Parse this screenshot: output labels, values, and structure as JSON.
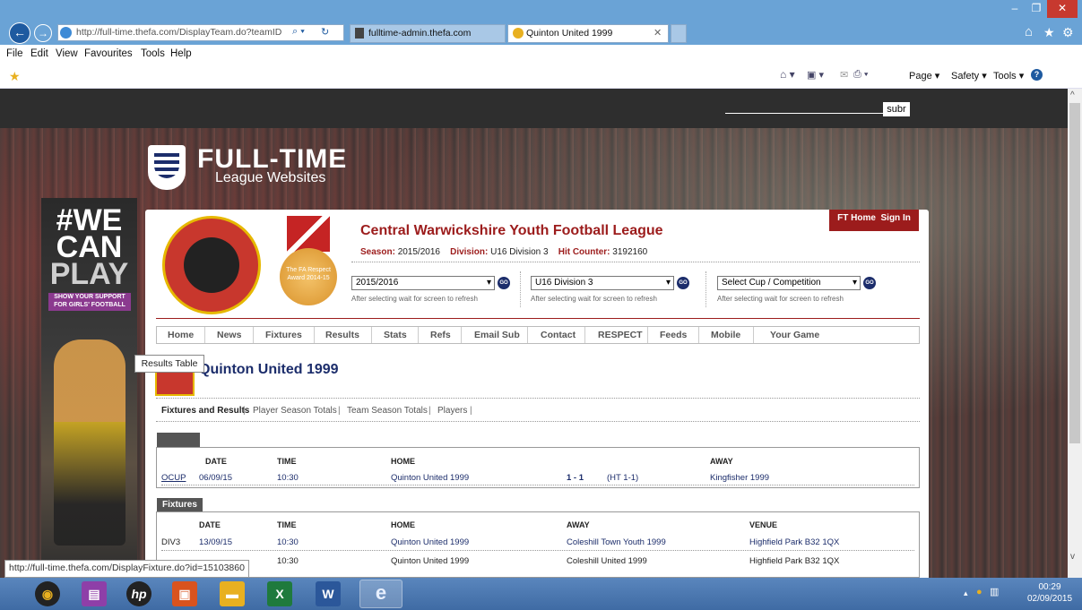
{
  "browser": {
    "address": "http://full-time.thefa.com/DisplayTeam.do?teamID",
    "tabs": [
      {
        "label": "fulltime-admin.thefa.com"
      },
      {
        "label": "Quinton United 1999"
      }
    ],
    "menu": [
      "File",
      "Edit",
      "View",
      "Favourites",
      "Tools",
      "Help"
    ],
    "commandbar": [
      "Page ▾",
      "Safety ▾",
      "Tools ▾"
    ],
    "window_buttons": [
      "–",
      "❐",
      "✕"
    ]
  },
  "site": {
    "submit_label": "subr",
    "logo_title": "FULL-TIME",
    "logo_subtitle": "League Websites",
    "banner_lines": [
      "#WE",
      "CAN",
      "PLAY"
    ],
    "banner_badge": "SHOW YOUR SUPPORT FOR GIRLS' FOOTBALL",
    "ft_home": "FT Home",
    "sign_in": "Sign In",
    "medal_text": "The FA Respect Award 2014-15"
  },
  "league": {
    "name": "Central Warwickshire Youth Football League",
    "season_label": "Season:",
    "season_value": "2015/2016",
    "division_label": "Division:",
    "division_value": "U16 Division 3",
    "counter_label": "Hit Counter:",
    "counter_value": "3192160"
  },
  "selectors": [
    {
      "value": "2015/2016",
      "hint": "After selecting wait for screen to refresh"
    },
    {
      "value": "U16 Division 3",
      "hint": "After selecting wait for screen to refresh"
    },
    {
      "value": "Select Cup / Competition",
      "hint": "After selecting wait for screen to refresh"
    }
  ],
  "go_label": "GO",
  "nav": [
    "Home",
    "News",
    "Fixtures",
    "Results",
    "Stats",
    "Refs",
    "Email Sub",
    "Contact",
    "RESPECT",
    "Feeds",
    "Mobile",
    "Your Game"
  ],
  "team": {
    "name": "Quinton United 1999",
    "subnav": [
      "Fixtures and Results",
      "Player Season Totals",
      "Team Season Totals",
      "Players"
    ]
  },
  "results": {
    "headers": [
      "DATE",
      "TIME",
      "HOME",
      "AWAY"
    ],
    "rows": [
      {
        "comp": "OCUP",
        "date": "06/09/15",
        "time": "10:30",
        "home": "Quinton United 1999",
        "score": "1 - 1",
        "ht": "(HT 1-1)",
        "away": "Kingfisher 1999"
      }
    ]
  },
  "tooltip": "Results Table",
  "fixtures": {
    "title": "Fixtures",
    "headers": [
      "DATE",
      "TIME",
      "HOME",
      "AWAY",
      "VENUE"
    ],
    "rows": [
      {
        "comp": "DIV3",
        "date": "13/09/15",
        "time": "10:30",
        "home": "Quinton United 1999",
        "away": "Coleshill Town Youth 1999",
        "venue": "Highfield Park B32 1QX"
      },
      {
        "comp": "",
        "date": "",
        "time": "10:30",
        "home": "Quinton United 1999",
        "away": "Coleshill United 1999",
        "venue": "Highfield Park B32 1QX"
      }
    ]
  },
  "status_url": "http://full-time.thefa.com/DisplayFixture.do?id=15103860",
  "clock": {
    "time": "00:29",
    "date": "02/09/2015"
  }
}
